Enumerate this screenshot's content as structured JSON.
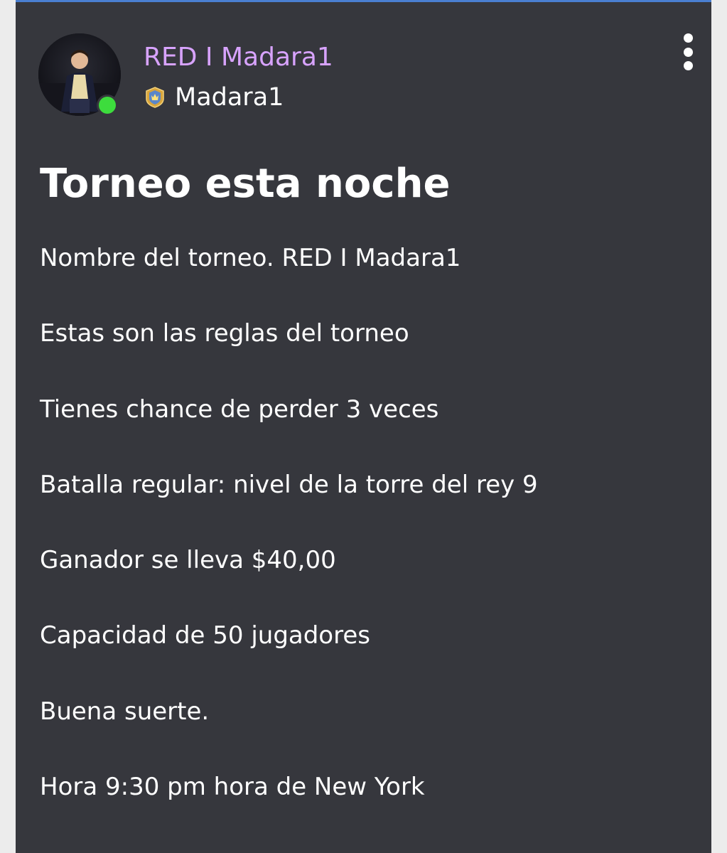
{
  "post": {
    "author": {
      "display_name": "RED I Madara1",
      "display_name_color": "#d8a3ff",
      "online_status_color": "#3ddc3d",
      "avatar": "profile-photo",
      "clan": {
        "icon": "clan-badge-icon",
        "name": "Madara1"
      }
    },
    "more_menu_icon": "more-vertical-icon",
    "title": "Torneo esta noche",
    "body_lines": [
      "Nombre del torneo. RED I Madara1",
      "Estas son las reglas del torneo",
      "Tienes chance de perder 3 veces",
      "Batalla regular: nivel de la torre del rey 9",
      "Ganador se lleva $40,00",
      "Capacidad de 50 jugadores",
      "Buena suerte.",
      "Hora 9:30 pm hora de New York"
    ]
  },
  "colors": {
    "card_background": "#36373d",
    "top_accent": "#4a7fd1",
    "text": "#ffffff"
  }
}
